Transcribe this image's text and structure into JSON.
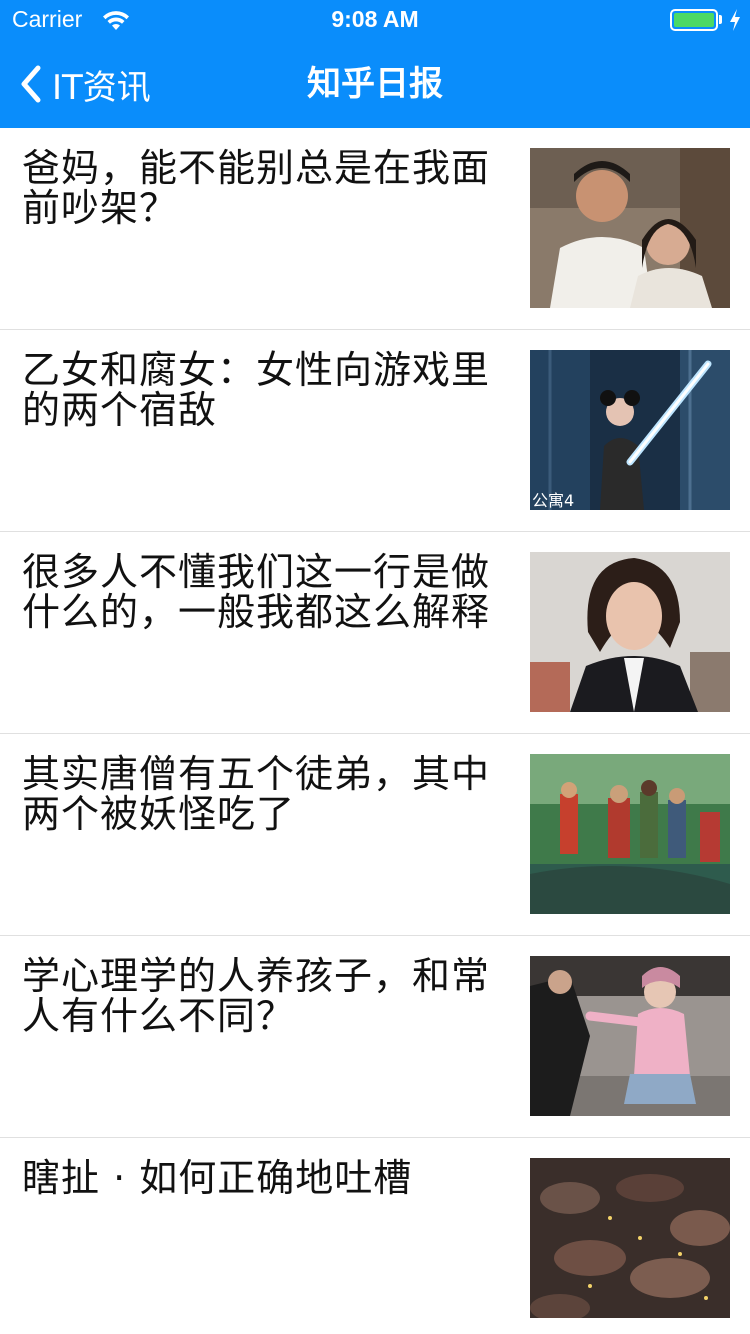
{
  "status_bar": {
    "carrier": "Carrier",
    "time": "9:08 AM",
    "battery_level": 1.0,
    "battery_color": "#4cd964"
  },
  "nav": {
    "back_label": "IT资讯",
    "title": "知乎日报",
    "background": "#0a8dfb"
  },
  "articles": [
    {
      "title": "爸妈，能不能别总是在我面前吵架？",
      "thumbnail": "couple-photo"
    },
    {
      "title": "乙女和腐女：女性向游戏里的两个宿敌",
      "thumbnail": "lightsaber-photo",
      "thumbnail_caption": "公寓4"
    },
    {
      "title": "很多人不懂我们这一行是做什么的，一般我都这么解释",
      "thumbnail": "woman-portrait-photo"
    },
    {
      "title": "其实唐僧有五个徒弟，其中两个被妖怪吃了",
      "thumbnail": "boat-scene-photo"
    },
    {
      "title": "学心理学的人养孩子，和常人有什么不同？",
      "thumbnail": "street-scene-photo"
    },
    {
      "title": "瞎扯 · 如何正确地吐槽",
      "thumbnail": "crowd-photo"
    }
  ]
}
